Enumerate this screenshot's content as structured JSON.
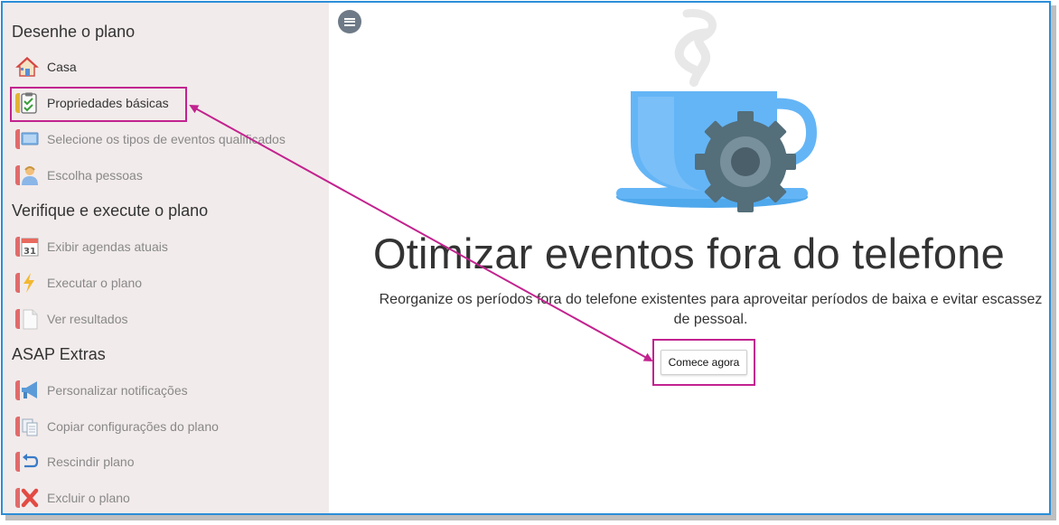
{
  "sidebar": {
    "sections": [
      {
        "title": "Desenhe o plano",
        "items": [
          {
            "label": "Casa",
            "icon": "house-icon",
            "enabled": true
          },
          {
            "label": "Propriedades básicas",
            "icon": "checklist-icon",
            "enabled": true
          },
          {
            "label": "Selecione os tipos de eventos qualificados",
            "icon": "monitor-icon",
            "enabled": false
          },
          {
            "label": "Escolha pessoas",
            "icon": "person-icon",
            "enabled": false
          }
        ]
      },
      {
        "title": "Verifique e execute o plano",
        "items": [
          {
            "label": "Exibir agendas atuais",
            "icon": "calendar-icon",
            "enabled": false,
            "badge": "31"
          },
          {
            "label": "Executar o plano",
            "icon": "lightning-icon",
            "enabled": false
          },
          {
            "label": "Ver resultados",
            "icon": "document-icon",
            "enabled": false
          }
        ]
      },
      {
        "title": "ASAP Extras",
        "items": [
          {
            "label": "Personalizar notificações",
            "icon": "megaphone-icon",
            "enabled": false
          },
          {
            "label": "Copiar configurações do plano",
            "icon": "copy-icon",
            "enabled": false
          },
          {
            "label": "Rescindir plano",
            "icon": "undo-arrow-icon",
            "enabled": false
          },
          {
            "label": "Excluir o plano",
            "icon": "delete-x-icon",
            "enabled": false
          }
        ]
      }
    ]
  },
  "main": {
    "menu_icon": "hamburger-menu-icon",
    "hero_icon": "coffee-cup-gear-icon",
    "title": "Otimizar eventos fora do telefone",
    "subtitle": "Reorganize os períodos fora do telefone existentes para aproveitar períodos de baixa e evitar escassez de pessoal.",
    "start_button": "Comece agora"
  },
  "colors": {
    "sidebar_bg": "#f2ebeb",
    "highlight": "#c2238f",
    "frame_border": "#2b8ed8",
    "cup": "#64b5f6",
    "gear": "#546e7a"
  }
}
